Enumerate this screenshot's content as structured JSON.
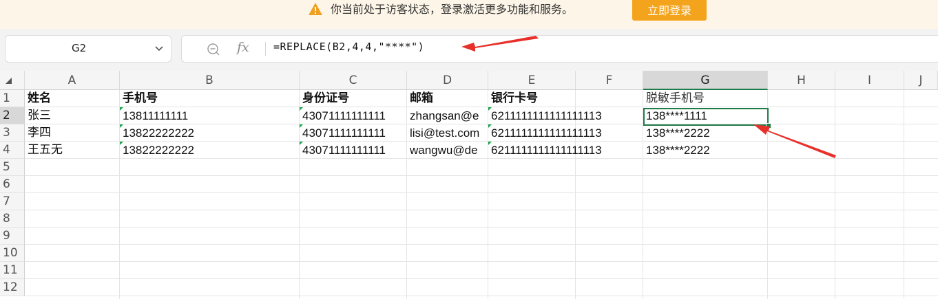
{
  "banner": {
    "message": "你当前处于访客状态，登录激活更多功能和服务。",
    "login_button": "立即登录"
  },
  "namebox": {
    "value": "G2"
  },
  "formula_bar": {
    "formula": "=REPLACE(B2,4,4,\"****\")",
    "fx_label": "fx"
  },
  "columns": [
    "A",
    "B",
    "C",
    "D",
    "E",
    "F",
    "G",
    "H",
    "I",
    "J"
  ],
  "rows": [
    "1",
    "2",
    "3",
    "4",
    "5",
    "6",
    "7",
    "8",
    "9",
    "10",
    "11",
    "12"
  ],
  "headers": {
    "name": "姓名",
    "phone": "手机号",
    "id_number": "身份证号",
    "email": "邮箱",
    "bank_card": "银行卡号",
    "masked_phone": "脱敏手机号"
  },
  "data_rows": [
    {
      "name": "张三",
      "phone": "13811111111",
      "id_number": "43071111111111",
      "email": "zhangsan@e",
      "bank_card": "6211111111111111113",
      "masked_phone": "138****1111"
    },
    {
      "name": "李四",
      "phone": "13822222222",
      "id_number": "43071111111111",
      "email": "lisi@test.com",
      "bank_card": "6211111111111111113",
      "masked_phone": "138****2222"
    },
    {
      "name": "王五无",
      "phone": "13822222222",
      "id_number": "43071111111111",
      "email": "wangwu@de",
      "bank_card": "6211111111111111113",
      "masked_phone": "138****2222"
    }
  ],
  "selected_cell": "G2",
  "colors": {
    "accent": "#1f7b49",
    "banner_button": "#f4a31c",
    "arrow": "#e8302a"
  }
}
